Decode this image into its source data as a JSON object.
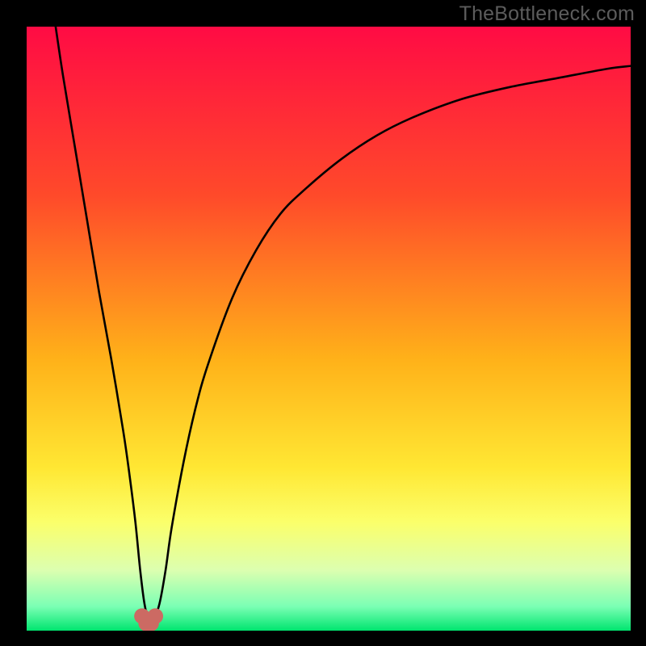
{
  "watermark": "TheBottleneck.com",
  "chart_data": {
    "type": "line",
    "title": "",
    "xlabel": "",
    "ylabel": "",
    "xlim": [
      0,
      100
    ],
    "ylim": [
      0,
      100
    ],
    "grid": false,
    "legend": false,
    "gradient_stops": [
      {
        "offset": 0,
        "color": "#ff0b44"
      },
      {
        "offset": 0.28,
        "color": "#ff4a2a"
      },
      {
        "offset": 0.55,
        "color": "#ffb119"
      },
      {
        "offset": 0.73,
        "color": "#ffe733"
      },
      {
        "offset": 0.82,
        "color": "#fbff6a"
      },
      {
        "offset": 0.9,
        "color": "#dcffb0"
      },
      {
        "offset": 0.96,
        "color": "#7bffb4"
      },
      {
        "offset": 1.0,
        "color": "#00e56f"
      }
    ],
    "series": [
      {
        "name": "bottleneck-curve",
        "x": [
          4.8,
          6,
          8,
          10,
          12,
          14,
          16,
          17,
          18,
          18.8,
          19.5,
          20.2,
          21,
          22,
          23,
          24,
          26,
          28,
          30,
          34,
          38,
          42,
          46,
          52,
          58,
          64,
          72,
          80,
          88,
          96,
          100
        ],
        "y": [
          100,
          92,
          80,
          68,
          56,
          45,
          33,
          26,
          18,
          10,
          4.5,
          1.8,
          1.8,
          4.5,
          10,
          17,
          28,
          37,
          44,
          55,
          63,
          69,
          73,
          78,
          82,
          85,
          88,
          90,
          91.5,
          93,
          93.5
        ]
      }
    ],
    "markers": [
      {
        "name": "sweet-spot-left",
        "x": 19.1,
        "y": 2.4,
        "r": 1.3,
        "color": "#cc6a63"
      },
      {
        "name": "sweet-spot-mid1",
        "x": 19.8,
        "y": 1.2,
        "r": 1.3,
        "color": "#cc6a63"
      },
      {
        "name": "sweet-spot-mid2",
        "x": 20.6,
        "y": 1.2,
        "r": 1.3,
        "color": "#cc6a63"
      },
      {
        "name": "sweet-spot-right",
        "x": 21.3,
        "y": 2.4,
        "r": 1.3,
        "color": "#cc6a63"
      }
    ]
  }
}
